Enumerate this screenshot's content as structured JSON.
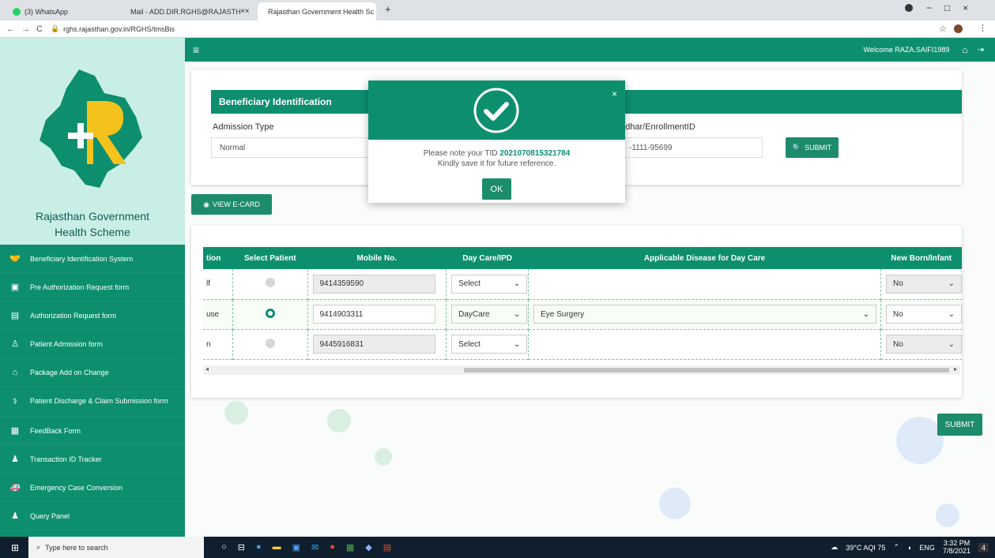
{
  "browser": {
    "tabs": [
      {
        "label": "(3) WhatsApp",
        "close": "×"
      },
      {
        "label": "Mail - ADD.DIR.RGHS@RAJASTH",
        "close": "×"
      },
      {
        "label": "Rajasthan Government Health Sc",
        "close": "×"
      }
    ],
    "new_tab": "+",
    "url": "rghs.rajasthan.gov.in/RGHS/tmsBis",
    "window_controls": [
      "−",
      "□",
      "×"
    ]
  },
  "brand": {
    "line1": "Rajasthan Government",
    "line2": "Health Scheme"
  },
  "sidebar": {
    "items": [
      {
        "label": "Beneficiary Identification System",
        "icon": "handshake-icon"
      },
      {
        "label": "Pre Authorization Request form",
        "icon": "monitor-icon"
      },
      {
        "label": "Authorization Request form",
        "icon": "doc-icon"
      },
      {
        "label": "Patient Admission form",
        "icon": "patient-icon"
      },
      {
        "label": "Package Add on Change",
        "icon": "package-icon"
      },
      {
        "label": "Patient Discharge & Claim Submission form",
        "icon": "stethoscope-icon"
      },
      {
        "label": "FeedBack Form",
        "icon": "feedback-icon"
      },
      {
        "label": "Transaction ID Tracker",
        "icon": "tracker-icon"
      },
      {
        "label": "Emergency Case Conversion",
        "icon": "ambulance-icon"
      },
      {
        "label": "Query Panel",
        "icon": "query-icon"
      }
    ]
  },
  "header": {
    "menu_icon": "≡",
    "welcome": "Welcome RAZA.SAIFI1989",
    "home_icon": "⌂",
    "logout_icon": "⇥"
  },
  "identification": {
    "title": "Beneficiary Identification",
    "admission_label": "Admission Type",
    "admission_value": "Normal",
    "aadhar_label": "adhar/EnrollmentID",
    "aadhar_value": "-1111-95699",
    "submit": "SUBMIT"
  },
  "view_ecard": "VIEW E-CARD",
  "table": {
    "headers": [
      "tion",
      "Select Patient",
      "Mobile No.",
      "Day Care/IPD",
      "Applicable Disease for Day Care",
      "New Born/Infant"
    ],
    "rows": [
      {
        "rel": "lf",
        "mobile": "9414359590",
        "daycare": "Select",
        "disease": "",
        "newborn": "No",
        "selected": false
      },
      {
        "rel": "use",
        "mobile": "9414903311",
        "daycare": "DayCare",
        "disease": "Eye Surgery",
        "newborn": "No",
        "selected": true
      },
      {
        "rel": "n",
        "mobile": "9445916831",
        "daycare": "Select",
        "disease": "",
        "newborn": "No",
        "selected": false
      }
    ]
  },
  "submit_main": "SUBMIT",
  "modal": {
    "line1_prefix": "Please note your TID ",
    "tid": "2021070815321784",
    "line2": "Kindly save it for future reference.",
    "ok": "OK",
    "close": "×"
  },
  "taskbar": {
    "search_placeholder": "Type here to search",
    "weather": "39°C AQI 75",
    "lang": "ENG",
    "time": "3:32 PM",
    "date": "7/8/2021",
    "notifications": "4"
  },
  "colors": {
    "primary": "#0d8f6f",
    "sidebar_bg": "#c9eee6",
    "tid": "#0d8f6f"
  }
}
